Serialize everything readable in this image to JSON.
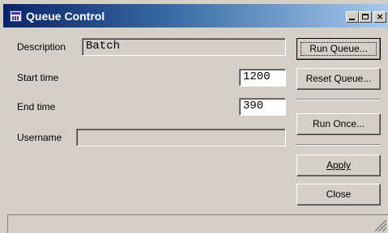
{
  "window": {
    "title": "Queue Control",
    "buttons": {
      "minimize": "minimize-icon",
      "maximize": "maximize-icon",
      "close": "×"
    }
  },
  "form": {
    "description": {
      "label": "Description",
      "value": "Batch"
    },
    "start_time": {
      "label": "Start time",
      "value": "1200"
    },
    "end_time": {
      "label": "End time",
      "value": "390"
    },
    "username": {
      "label": "Username",
      "value": ""
    }
  },
  "actions": {
    "run_queue": "Run Queue...",
    "reset_queue": "Reset Queue...",
    "run_once": "Run Once...",
    "apply": "Apply",
    "close": "Close"
  },
  "colors": {
    "titlebar_start": "#0a246a",
    "titlebar_end": "#a6caf0",
    "face": "#d4d0c8"
  }
}
